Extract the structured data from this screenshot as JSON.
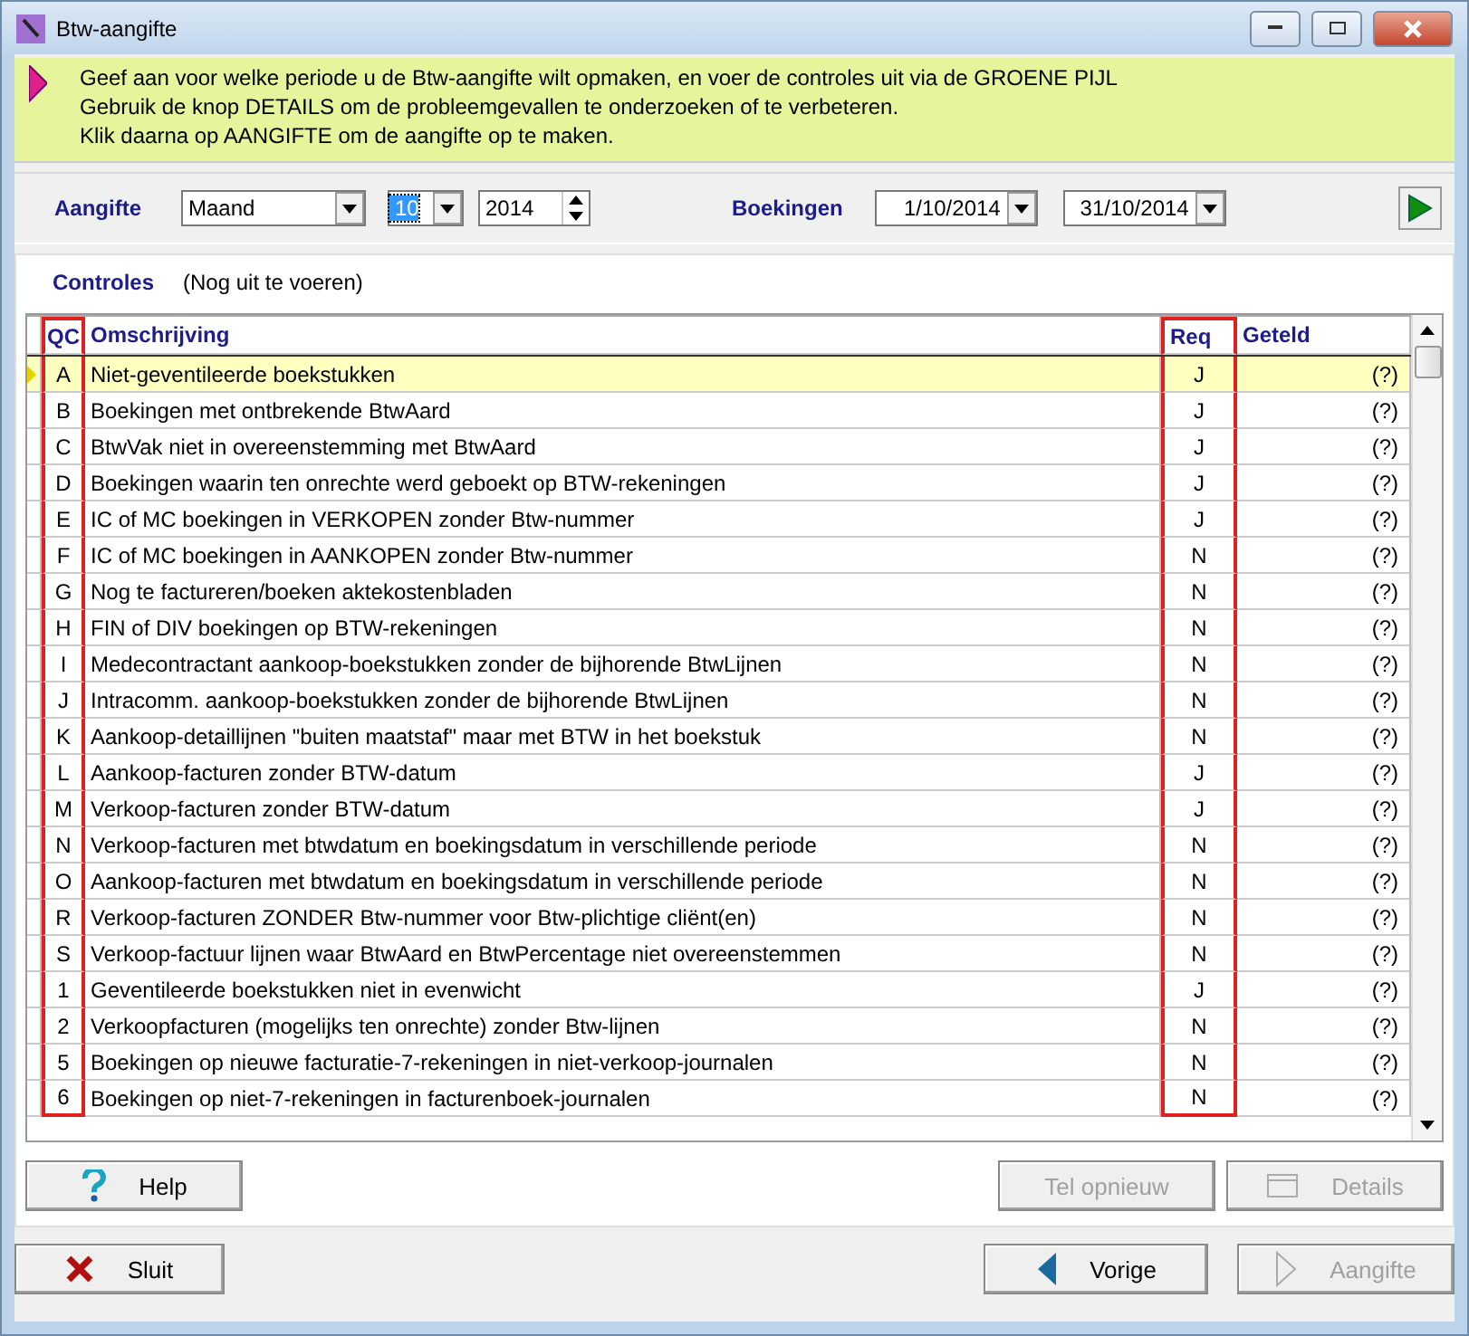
{
  "window": {
    "title": "Btw-aangifte"
  },
  "info": {
    "lines": [
      "Geef aan voor welke periode u de Btw-aangifte wilt opmaken, en voer de controles uit via de GROENE PIJL",
      "Gebruik de knop DETAILS om de probleemgevallen te onderzoeken of te verbeteren.",
      "Klik daarna op AANGIFTE om de aangifte op te maken."
    ]
  },
  "period": {
    "label": "Aangifte",
    "type": "Maand",
    "month": "10",
    "year": "2014",
    "bookings_label": "Boekingen",
    "from": "1/10/2014",
    "to": "31/10/2014"
  },
  "checks": {
    "label": "Controles",
    "status": "(Nog uit te voeren)"
  },
  "table": {
    "columns": [
      {
        "label": "QC",
        "highlighted": true
      },
      {
        "label": "Omschrijving",
        "highlighted": false
      },
      {
        "label": "Req",
        "highlighted": true
      },
      {
        "label": "Geteld",
        "highlighted": false
      }
    ],
    "rows": [
      {
        "qc": "A",
        "text": "Niet-geventileerde boekstukken",
        "req": "J",
        "count": "(?)",
        "selected": true
      },
      {
        "qc": "B",
        "text": "Boekingen met ontbrekende BtwAard",
        "req": "J",
        "count": "(?)",
        "selected": false
      },
      {
        "qc": "C",
        "text": "BtwVak niet in overeenstemming met BtwAard",
        "req": "J",
        "count": "(?)",
        "selected": false
      },
      {
        "qc": "D",
        "text": "Boekingen waarin ten onrechte werd geboekt op BTW-rekeningen",
        "req": "J",
        "count": "(?)",
        "selected": false
      },
      {
        "qc": "E",
        "text": "IC of MC boekingen in VERKOPEN zonder Btw-nummer",
        "req": "J",
        "count": "(?)",
        "selected": false
      },
      {
        "qc": "F",
        "text": "IC of MC boekingen in AANKOPEN zonder Btw-nummer",
        "req": "N",
        "count": "(?)",
        "selected": false
      },
      {
        "qc": "G",
        "text": "Nog te factureren/boeken aktekostenbladen",
        "req": "N",
        "count": "(?)",
        "selected": false
      },
      {
        "qc": "H",
        "text": "FIN of DIV boekingen op BTW-rekeningen",
        "req": "N",
        "count": "(?)",
        "selected": false
      },
      {
        "qc": "I",
        "text": "Medecontractant aankoop-boekstukken zonder de bijhorende BtwLijnen",
        "req": "N",
        "count": "(?)",
        "selected": false
      },
      {
        "qc": "J",
        "text": "Intracomm. aankoop-boekstukken zonder de bijhorende BtwLijnen",
        "req": "N",
        "count": "(?)",
        "selected": false
      },
      {
        "qc": "K",
        "text": "Aankoop-detaillijnen \"buiten maatstaf\" maar met BTW in het boekstuk",
        "req": "N",
        "count": "(?)",
        "selected": false
      },
      {
        "qc": "L",
        "text": "Aankoop-facturen zonder BTW-datum",
        "req": "J",
        "count": "(?)",
        "selected": false
      },
      {
        "qc": "M",
        "text": "Verkoop-facturen zonder BTW-datum",
        "req": "J",
        "count": "(?)",
        "selected": false
      },
      {
        "qc": "N",
        "text": "Verkoop-facturen met btwdatum en boekingsdatum in verschillende periode",
        "req": "N",
        "count": "(?)",
        "selected": false
      },
      {
        "qc": "O",
        "text": "Aankoop-facturen met btwdatum en boekingsdatum in verschillende periode",
        "req": "N",
        "count": "(?)",
        "selected": false
      },
      {
        "qc": "R",
        "text": "Verkoop-facturen ZONDER Btw-nummer voor Btw-plichtige cliënt(en)",
        "req": "N",
        "count": "(?)",
        "selected": false
      },
      {
        "qc": "S",
        "text": "Verkoop-factuur lijnen waar BtwAard en BtwPercentage niet overeenstemmen",
        "req": "N",
        "count": "(?)",
        "selected": false
      },
      {
        "qc": "1",
        "text": "Geventileerde boekstukken niet in evenwicht",
        "req": "J",
        "count": "(?)",
        "selected": false
      },
      {
        "qc": "2",
        "text": "Verkoopfacturen (mogelijks ten onrechte) zonder Btw-lijnen",
        "req": "N",
        "count": "(?)",
        "selected": false
      },
      {
        "qc": "5",
        "text": "Boekingen op nieuwe facturatie-7-rekeningen in niet-verkoop-journalen",
        "req": "N",
        "count": "(?)",
        "selected": false
      },
      {
        "qc": "6",
        "text": "Boekingen op niet-7-rekeningen in facturenboek-journalen",
        "req": "N",
        "count": "(?)",
        "selected": false
      }
    ]
  },
  "panel_buttons": [
    {
      "label": "Help",
      "kind": "help",
      "disabled": false
    },
    {
      "label": "Tel opnieuw",
      "kind": "plain",
      "disabled": true
    },
    {
      "label": "Details",
      "kind": "details",
      "disabled": true
    }
  ],
  "footer_buttons": [
    {
      "label": "Sluit",
      "kind": "close",
      "disabled": false
    },
    {
      "label": "Vorige",
      "kind": "back",
      "disabled": false
    },
    {
      "label": "Aangifte",
      "kind": "forward",
      "disabled": true
    }
  ]
}
